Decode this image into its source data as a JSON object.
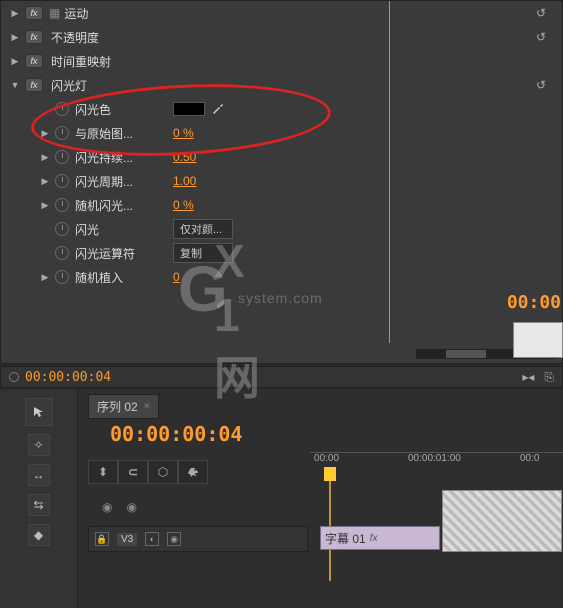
{
  "effects": {
    "motion": {
      "label": "运动"
    },
    "opacity": {
      "label": "不透明度"
    },
    "timeremap": {
      "label": "时间重映射"
    },
    "strobe": {
      "label": "闪光灯",
      "props": {
        "color": {
          "label": "闪光色"
        },
        "blend": {
          "label": "与原始图...",
          "value": "0 %"
        },
        "duration": {
          "label": "闪光持续...",
          "value": "0.50"
        },
        "period": {
          "label": "闪光周期...",
          "value": "1.00"
        },
        "random": {
          "label": "随机闪光...",
          "value": "0 %"
        },
        "strobe": {
          "label": "闪光",
          "value": "仅对颜..."
        },
        "operator": {
          "label": "闪光运算符",
          "value": "复制"
        },
        "seed": {
          "label": "随机植入",
          "value": "0"
        }
      }
    }
  },
  "status": {
    "timecode": "00:00:00:04"
  },
  "timeline": {
    "tab": "序列 02",
    "timecode": "00:00:00:04",
    "rightTimecode": "00:00",
    "ruler": {
      "t0": "00:00",
      "t1": "00:00:01:00",
      "t2": "00:0"
    },
    "track": {
      "label": "V3"
    },
    "clip": {
      "name": "字幕 01",
      "fx": "fx"
    }
  },
  "watermark": {
    "brand": "X 1网",
    "sub": "system.com",
    "g": "G"
  }
}
